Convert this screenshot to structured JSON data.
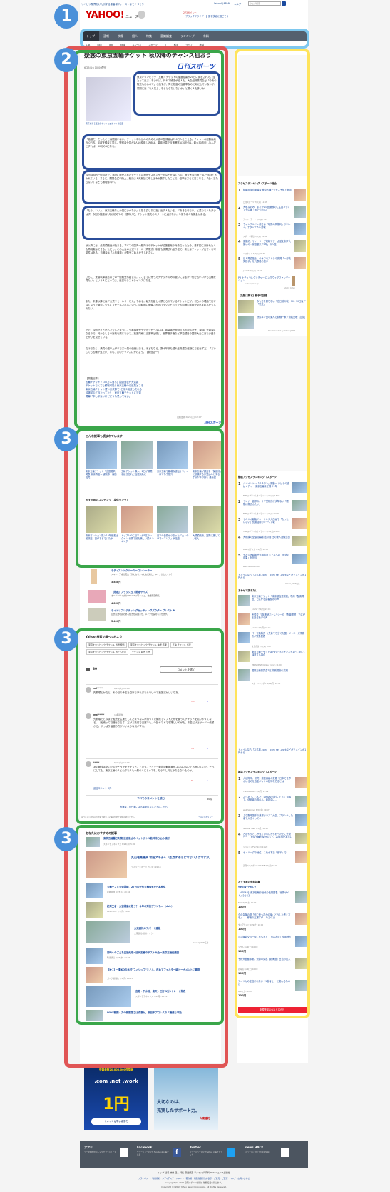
{
  "topbar": {
    "tagline": "リハビリ業界をけん引する患者様ファーストなモノづくり",
    "links": [
      "Yahoo! JAPAN",
      "ヘルプ"
    ],
    "search_placeholder": "ウェブ検索"
  },
  "header": {
    "logo": "YAHOO!",
    "logo_sub": "JAPAN",
    "service": "ニュース",
    "promo1": "273ポイント",
    "promo2": "【ブラックフライデー】夏を快適に過ごそう"
  },
  "nav": {
    "tabs": [
      "トップ",
      "速報",
      "映像",
      "個人",
      "特集",
      "意識調査",
      "ランキング",
      "有料"
    ],
    "sub": [
      "主要",
      "国内",
      "国際",
      "経済",
      "エンタメ",
      "スポーツ",
      "IT",
      "科学",
      "ライフ",
      "地域"
    ]
  },
  "badges": [
    "1",
    "2",
    "3",
    "3",
    "3"
  ],
  "article": {
    "title": "疑惑の東京五輪チケット 秋以降のチャンス狙おう",
    "date": "6/25(火) 10:00配信",
    "source_logo": "日刊スポーツ",
    "photo_caption": "東京を彩る五輪チケット公式サイトの画面",
    "p1": "東京オリンピック（五輪）チケットの抽選結果が20日に発表された。当たって喜ぶ人もいれば、外れて残念がる人も。大会組織委員会は「今後の販売もあるので」と話すが、同じ程度の当選率なのに気にしていないが、同期には「なんだよ、もうとらないないか」と嘆く人も多いか。",
    "p2": "「抽選だ」だったことは間違いない。チケット申し込みのための大会ID登録者は750万人をこえる。チケットの総数は約780万枚。ほぼ登録者と同じ。登録者全員が1人10枚申し込めば、単純計算で当選確率は10分の1。最大30枚申し込んだとすれば、30分の1になる。",
    "p3": "今回は国内一般向けで、実際に販売されたチケットは海外やスポンサー分などを除くもの。過去大会の例では7〜8割と言われている。さらに、開閉会式や陸上、競泳は人気競技に申し込みが集中したことで、倍率はさらに高くなる。「全く当たらない」なども無理はない。",
    "p4": "「もう、いいよ。東京五輪なんか見にいかない」と怒り交じりに言い出す人もいる。「あきらめない」と重ねる人も多いはず。今回の抽選は7月に初めての一般向けで、チケット販売のスタートに過ぎない。今後も様々な機会がある。",
    "p5": "秋以降には、先着順販売が始まる。すべての国内一般向けのチケットが抽選販売の対象だったため、基本的には外れた人も再挑戦はできる。ただし、この大会の公式リセール（再販売）制度も設置される予定で、新たなチケットが出てくる可能性はある。当選者は「人気競技」が販売されるかもしれない。",
    "p6": "さらに、来春以降は窓口での一般販売も始まる。ここまでに残ったチケットのみの扱いになるが「何でもいいから五輪を見たい」という人にとっては、貴重なラストチャンスになる。",
    "p7": "また、来春以降には「公式リセールサービス」もある。転売を厳しく禁じられているチケットだが、何らかの理由で行けなくなった場合に公式にリセールされるという。同時期に開催されるパラリンピックでも同様の手段が見込まれるかもしれない。",
    "p8": "ただ、今回サイトがパンクしたように、先着順販売や公式リセールには、希望者が殺到する可能性が大。単純に先着順になるので、何からしらの対策を講じないと、抽選同様に当選率は低い。世界選手権など単独種目の国際大会にはない盛り上がりを見せている。",
    "p9": "だけでなく、満員の盛り上がりなど一見の価値はある。子どもなら、数十年後も語れる貴重な経験になるはずだ。「どうしても五輪が見たい」なら、次のチャンスにかけよう。【荻島弘一】",
    "related_title": "【関連記事】",
    "related": [
      "五輪チケット「100万人落ち」抽選発表が大混雑",
      "チケットなくても観戦可能！東京五輪の沿道見どころ",
      "東京五輪チケット買い方決算で1日後3競技も売れる",
      "抽選前の「当たってた！」東京五輪チケットに当選",
      "開幕「申し訳ないけどどうも思ってない」"
    ],
    "updated": "最終更新:6/25(火) 12:07",
    "footer_logo": "日刊スポーツ"
  },
  "also_read": {
    "title": "こんな記事も読まれています",
    "items": [
      {
        "text": "東京五輪チケット「当選確率」発表 東京再度へ 観戦券・高額転売",
        "meta": "6/25(火) 16:58 スポーツ"
      },
      {
        "text": "五輪チケット購入、2日が期限 手続き忘れと当選無効に",
        "meta": "7/1(月) 15:36 共同通信"
      },
      {
        "text": "東京五輪で顕著な逆転オリ、メトロでも予想外",
        "meta": "6/26(水) 19:46 NHK 日本経済新聞"
      },
      {
        "text": "東京五輪が調査を「保健省」に依頼する件見込みとする子供や手の感じ 難易度",
        "meta": "6/24(月) 6:39 ZAKZAK"
      }
    ],
    "ad_label": "おすすめのコンテンツ（提供リンク）",
    "ads": [
      {
        "text": "新築マンション購入10年後各比較検証！誰がするでいたか",
        "meta": "住まいサーフィン(提供リンク)"
      },
      {
        "text": "トップ100に日本人が5名ランクイン 世界で最も美しい顔ランキング",
        "meta": "NewSphere"
      },
      {
        "text": "日本の自然がつまった「大人のサマーエリア」が話題！",
        "meta": "東京新宿区CMCLASSE(提供リンク)"
      },
      {
        "text": "大規模改築、実際に施しているん",
        "meta": "ストスアイン(提供リンク)"
      }
    ]
  },
  "shop_ads": [
    {
      "title": "ラディアントクリーミーコンシーラー",
      "desc": "スキンケア成分配合で気になるクマにも密着し、メイクがしにくい？",
      "price": "3,888円"
    },
    {
      "title": "【限定】ブラッシュ / 限定サイズ",
      "desc": "オーバーサイズのGRAASHブラッシュ。数量限定発売。",
      "price": "4,860円"
    },
    {
      "title": "ライトリフレクティングセッティングパウダー プレスト N",
      "desc": "自然な透明感のある輝きを完成させ、メイクを長持ちさせます。",
      "price": "5,400円"
    }
  ],
  "search_section": {
    "title": "Yahoo!検索で調べてみよう",
    "tags": [
      "東京オリンピック チケット 当選 発表",
      "東京オリンピック チケット 抽選 結果",
      "五輪 チケット 当選",
      "東京オリンピック チケット 当たらない",
      "チケット 転売 公式"
    ]
  },
  "comments": {
    "count": "30",
    "write_button": "コメントを書く",
    "items": [
      {
        "user": "sai*****",
        "time": "6/25(火) 10:14",
        "text": "先着順とかだと、その日の予定を空けなければならないので抽選式がいいなあ。",
        "up": "163",
        "down": "8"
      },
      {
        "user": "mat*****",
        "time": "14時間前",
        "text": "先着順だと今まで転売を生業としてたような人が持ってた機械でソフトだかを使ってチケットを買いやすくなる。（転売って割増はならさ）だけど先着で当選でも、今回ヤマトでも難しいやがも、お金だけはサーバー依頼から。やっぱり抽選の方がいいような気がする。",
        "up": "14",
        "down": "0"
      },
      {
        "user": "*****",
        "time": "6/25(火) 10:04",
        "text": "あの競技は全いたのかどうかをチケット、という、マイナー競技の観戦客がコンなさないとも聞いていた。それにしても、東京五輪の人と公平な人も一般の人にとっても、もう少し何とかならないものか。",
        "up": "8",
        "down": "1"
      }
    ],
    "reply_link": "返信コメント 3件",
    "read_all": "すべてのコメントを読む",
    "read_all_count": "30件",
    "expert_link": "有識者、専門家による最新のコメントはこちら",
    "notice": "※コメントは個人の見解であり、記事提供社と関係はありません。",
    "policy": "コメントポリシー"
  },
  "recommended": {
    "title": "あなたにおすすめの記事",
    "items": [
      {
        "text": "東京五輪暑さ対策 送迎禁止のペットボトル飲料持ち込み検討",
        "meta": "スポニチアネックス 6/26(水) 5:30"
      },
      {
        "text": "丸山竜馬議員 和田アキ子へ「応点するほどでないようですが」",
        "meta": "デイリースポーツ 7/1(月) 19:18"
      },
      {
        "text": "五輪チスト大会導線、27日の近代五輪WRから本格化",
        "meta": "産経新聞 6/25(火) 20:32"
      },
      {
        "text": "絶対王者・大宮桐蔭に敗う？ 今年の対抗プランも…（dot.）",
        "meta": "AERA dot. 7/1(月) 16:00"
      },
      {
        "text": "大東建託のアパート建設",
        "meta": "大東建託(提供リンク)"
      },
      {
        "text": "同時へのごえを支援処理=近代五輪のテスト大会ー東京五輪組織委",
        "meta": "時事通信 6/26(水) 22:07"
      },
      {
        "text": "【K-1】一撃KOの木村\"フィリップ\"ミノル、改めてフェルター級トーナメントに意欲",
        "meta": "ゴング格闘技 7/1(月) 20:33"
      },
      {
        "text": "広島・下水流、楽天・三好 1対1トレード発表",
        "meta": "スポニチアネックス 7/1(月) 19:14"
      },
      {
        "text": "WWE戦闘人力の新聞第さは得意か。新日本プロレスの「通義な非独",
        "meta": ""
      }
    ],
    "yahoo_note": "Yahoo! JAPAN広告"
  },
  "sidebar": {
    "ranking1_title": "アクセスランキング（スポーツ総合）",
    "ranking1": [
      {
        "n": "1",
        "text": "桐朝用試合開催者 東京五輪アクセス予想と参加",
        "meta": "日刊スポーツ 7/2(火) 11:47"
      },
      {
        "n": "2",
        "text": "大坂なおみ、まさかの1回戦敗のに主要メディアも中継「進でやめる」",
        "meta": "デイリーアート 7/2(火) 7:19"
      },
      {
        "n": "3",
        "text": "ウィンブルドン前日は「暗黙の共権利」がベレン、チタンアメル対戦",
        "meta": "スポーツ報知 7/2(火) 10:41"
      },
      {
        "n": "4",
        "text": "遂撤約、サヤーリーグ初戦です一点差を制す大勝いの…家庭裏来「8年」の人生",
        "meta": "バスケット 7/2(火) 11:48"
      },
      {
        "n": "5",
        "text": "巨人再逆独を、今オフ以ストラの先発「一部先発投手」を代表格の選手",
        "meta": "J-CAST 7/2(火) 15:32"
      }
    ],
    "pr_text": "PR ナチュラルグリチャー ロングウェアファンデーション",
    "pr_meta": "naturaglace.jp",
    "ads_by": "Ads by Criteo",
    "battle_title": "【話題に関す】戦争の記憶",
    "battle_items": [
      {
        "text": "今も日を察ちない「忘日前の戦」70・10日後ア「恐意」",
        "meta": ""
      },
      {
        "text": "野菜軍で田の乗んだ前線一家「貴義安聴「記憶」",
        "meta": ""
      }
    ],
    "recommended_by": "Recommended by Yahoo! JAPAN",
    "ranking2_title": "動画アクセスランキング（スポーツ）",
    "ranking2": [
      {
        "n": "1",
        "text": "パバイントン「タチワン」躍動ー いばらの道はくチャー 東京五輪まで残り1年",
        "meta": "FNN.jpプライムオンライン 6/26(水) 13:07"
      },
      {
        "n": "2",
        "text": "ランナー誰呼の、サマ堂相的が決撃ない「眼険に振さんたい」",
        "meta": "FNN.jpプライムオンライン 7/2(火) 10:58"
      },
      {
        "n": "3",
        "text": "セルジオ越後ドキートレス大西はで「もったいない」長期活躍のキャリア戦",
        "meta": "FNN.jpプライムオンライン 6/30(日) 13:00"
      },
      {
        "n": "4",
        "text": "大相撲の全額 換量前法公開 比の東入選観当日",
        "meta": "WWEオチャム 7/1(月) 18:52"
      },
      {
        "text": "セルジオ越後が大相撲選 レアルへの「配対の成果」を担当",
        "n": "5",
        "meta": "www.onamae.com"
      }
    ],
    "onamae": "ドメインなら「お名前.com」 .com net .workなどがドメインが1円から",
    "yahoo_japan_ad": "Yahoo! JAPAN広告",
    "osusume_title": "あわせて読みたい",
    "osusume": [
      {
        "text": "東京五輪チケット「東京都当選発表」専用「配置問題」で広がる記者投げの声",
        "meta": "J-CAST 7/1(月) 23:03"
      },
      {
        "text": "予想変 77年連続ホームラン一位「配置問題」で広がる記者投げの声",
        "meta": "J-CAST 7/1(月) 23:03"
      },
      {
        "text": "パーマ無料式 〈先輩でも当てた国〉ジャニーズ事務所が緊急発表",
        "meta": "女性自身 7/2(火) 9:03"
      },
      {
        "text": "東京五輪チケットはどれだけお子ンスカ1上に新しく抽選する場合",
        "meta": "PRESIDENT Online 7/2(火) 11:00"
      },
      {
        "text": "国際五輪委員会7区 特別規制の文明",
        "meta": "スポーツニッポン 6/24(月) 10:43"
      }
    ],
    "onamae2": "ドメインなら「お名前.com」 .com net .workなどがドメインが1円から",
    "ranking3_title": "雑誌アクセスランキング（スポーツ）",
    "ranking3": [
      {
        "n": "1",
        "text": "大谷翔平、研究・発表番組の変更「日本で世界がいるのを自主バットの独特な方法とは",
        "meta": "THE ANSWER 7/1(月) 11:19"
      },
      {
        "n": "2",
        "text": "ぷりあ「こじんた」DeNAの今村にとって 起源で、伊勢者の数の人、競技中に…",
        "meta": "web Sportiva 6/27(木) 10:57"
      },
      {
        "n": "3",
        "text": "ぷり野球選手の熱球クラスコ大会、プラシナした者で大きくって…",
        "meta": "Number Web 7/1(月) 11:16"
      },
      {
        "n": "4",
        "text": "古谷やりとしか見ていないからわった上に先発ベー 「東京五輪も視野ネット、20年後が本当に",
        "meta": "ジョンソンTV 7/1(月) 11:20"
      },
      {
        "n": "5",
        "text": "セ・リーグの地位、これが本当「後半」で",
        "meta": "週刊ベースボールONLINE 7/1(月) 10:05"
      }
    ],
    "shop_title": "おすすめの有料記事",
    "shop_sub": "T-POINTでおトク",
    "shop_items": [
      {
        "text": "【ASEAN】東京五輪の世代の長期発表「世界サイト」【北斗】",
        "meta": "NNA 6/29(土) 10:00",
        "price": "100円"
      },
      {
        "text": "今の会場の際「何に使ったかの後」とうした考え方を」……即使の支援字が【人(ひと)】",
        "meta": "ダイアモンド 6/29(土) 10:00",
        "price": "100円"
      },
      {
        "text": "少な機能交の一般に比べると 「日本名の」全国地方",
        "meta": "ソウル 6/29(土) 10:00",
        "price": "100円"
      },
      {
        "text": "予約大首都事業、資源の見出【北海道】日当の出入",
        "meta": "北海道 6/29(土) 10:00",
        "price": "100円"
      },
      {
        "text": "アメリカの定住されない「1着者を」 に変わるものだ",
        "meta": "6/29(土) 10:00",
        "price": "100円"
      }
    ],
    "shop_more": "新規登録は今なら70円！"
  },
  "bottom_ads": {
    "left": {
      "line1": "登録者数20,000,000件突破",
      "line2": ".com .net .work",
      "line3": "1円",
      "line4": "ドメインは早い者勝ち"
    },
    "right": {
      "line1": "大切なのは、",
      "line2": "充実したサポート力。",
      "badge": "大東建託"
    }
  },
  "footer": {
    "apps": [
      "アプリ",
      "Facebook",
      "Twitter",
      "news HACK"
    ],
    "app_desc": [
      "データ節約中なら 完全ヤフーニュース",
      "ヤフーニュース公式 Facebook 記事を共有",
      "ヤフーニュース公式Twitter 記事をチェック",
      "ニュースについての最新情報"
    ],
    "links": [
      "トップ",
      "速報",
      "映像",
      "個人",
      "特集",
      "意識調査",
      "ランキング",
      "有料",
      "RSS",
      "ニュース提供社"
    ],
    "legal": "プライバシー・利用規約・メディアステートメント・著作権・特定商取引法の表示・ご意見・ご要望・ヘルプ・お問い合わせ",
    "copyright1": "Copyright (C) 2019 日刊スポーツ新聞社 無断転載を禁じます。",
    "copyright2": "Copyright (C) 2019 Yahoo Japan Corporation. All Rights Reserved."
  },
  "colors": {
    "outline_red": "#e05555",
    "outline_green": "#3aa64a",
    "outline_blue": "#2b4e9a",
    "outline_lightblue": "#7ec8ef",
    "outline_yellow": "#ffe45c",
    "badge": "#4a90d9"
  }
}
